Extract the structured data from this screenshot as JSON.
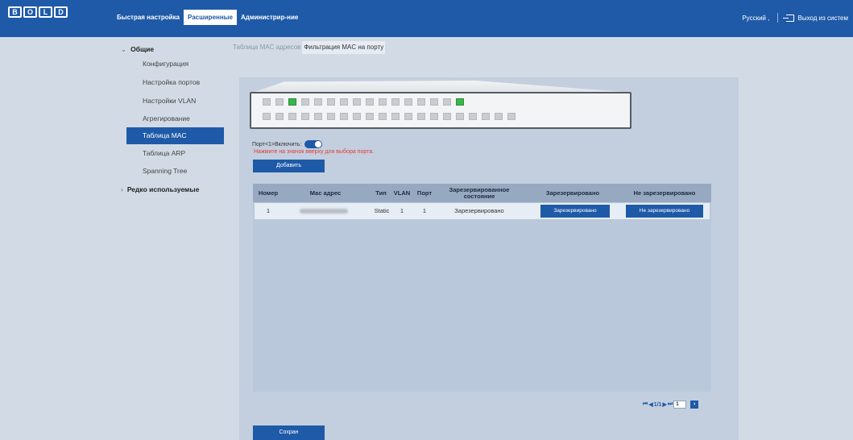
{
  "header": {
    "logo_letters": [
      "B",
      "O",
      "L",
      "D"
    ],
    "nav": [
      "Быстрая настройка",
      "Расширенные",
      "Администрир-ние"
    ],
    "active_nav": "Расширенные",
    "language": "Русский ,",
    "logout": "Выход из систем"
  },
  "sidebar": {
    "group_general": "Общие",
    "items": [
      "Конфигурация",
      "Настройка портов",
      "Настройки VLAN",
      "Агрегирование",
      "Таблица MAC",
      "Таблица ARP",
      "Spanning Tree"
    ],
    "active_item": "Таблица MAC",
    "group_rare": "Редко используемые"
  },
  "tabs": [
    "Таблица MAC адресов",
    "Фильтрация MAC на порту"
  ],
  "active_tab": "Фильтрация MAC на порту",
  "switch_panel": {
    "top_row_ports": 16,
    "bottom_row_ports": 20,
    "active_top_ports": [
      3,
      16
    ],
    "port_enable_label": "Порт<1>Включить:",
    "enabled": true,
    "hint": "Нажмите на значок вверху для выбора порта."
  },
  "buttons": {
    "add": "Добавить",
    "save": "Сохран"
  },
  "table": {
    "columns": [
      "Номер",
      "Mac адрес",
      "Тип",
      "VLAN",
      "Порт",
      "Зарезервированное состояние",
      "Зарезервировано",
      "Не зарезервировано"
    ],
    "rows": [
      {
        "num": "1",
        "mac": "",
        "type": "Static",
        "vlan": "1",
        "port": "1",
        "state": "Зарезервировано",
        "reserve_btn": "Зарезервировано",
        "unreserve_btn": "Не зарезервировано"
      }
    ]
  },
  "pagination": {
    "first": "⏮",
    "prev": "◀",
    "page_text": "1/1",
    "next": "▶",
    "last": "⏭",
    "page_input": "1",
    "go": "›"
  },
  "colors": {
    "topbar": "#1f5aa8",
    "background": "#d2dbe5",
    "panel": "#c3cfde",
    "accent": "#1f5aa8",
    "hint": "#e23a3a",
    "port_on": "#3cb44a"
  }
}
